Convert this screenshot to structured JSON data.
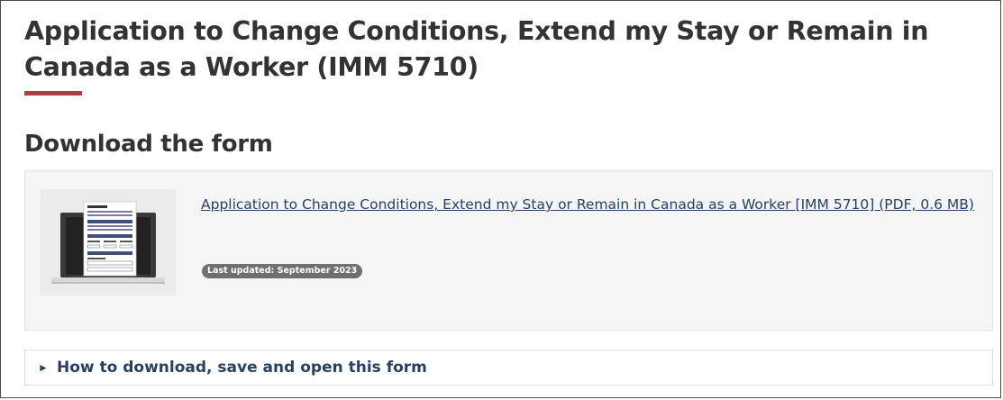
{
  "page": {
    "title": "Application to Change Conditions, Extend my Stay or Remain in Canada as a Worker (IMM 5710)"
  },
  "download": {
    "heading": "Download the form",
    "form_link_text": "Application to Change Conditions, Extend my Stay or Remain in Canada as a Worker [IMM 5710] (PDF, 0.6 MB)",
    "badge": "Last updated: September 2023",
    "thumbnail_icon": "form-on-screen-icon"
  },
  "details": {
    "arrow_icon": "triangle-right-icon",
    "arrow_glyph": "►",
    "summary": "How to download, save and open this form"
  },
  "colors": {
    "accent_underline": "#af3c43",
    "link": "#284162",
    "badge_bg": "#6f6f6f",
    "well_bg": "#f5f5f5"
  }
}
